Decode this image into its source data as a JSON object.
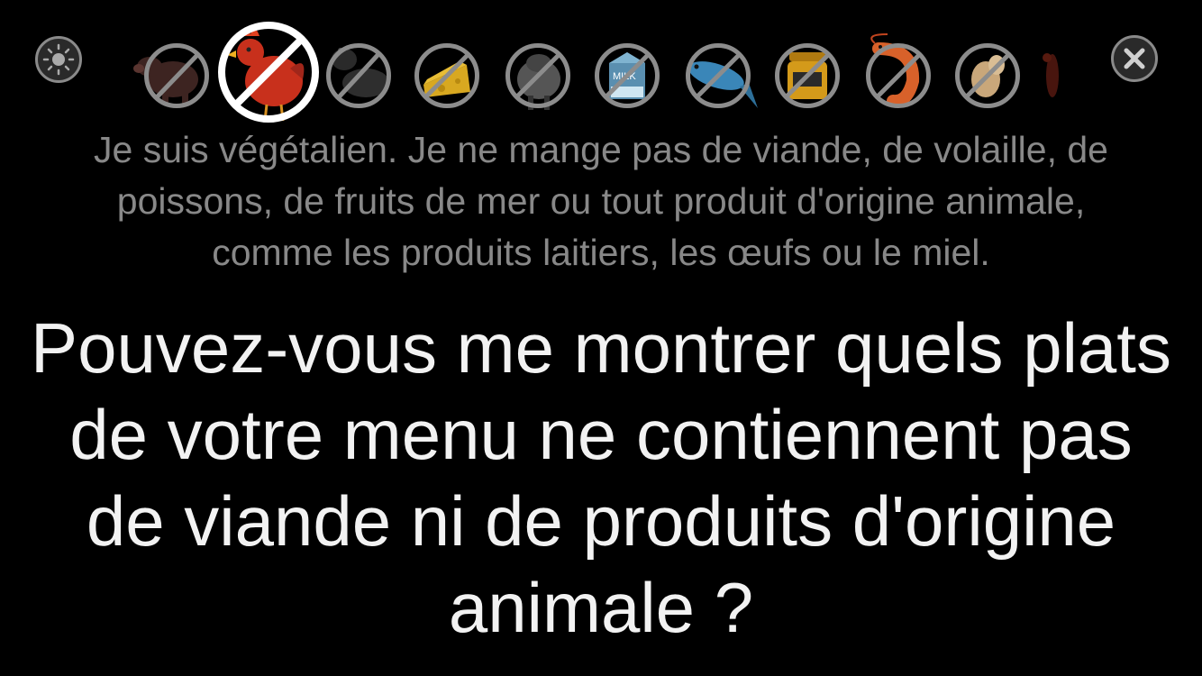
{
  "toolbar": {
    "brightness_icon": "sun-icon",
    "close_icon": "close-x-icon",
    "categories": [
      {
        "name": "pig",
        "icon": "pig-icon",
        "selected": false
      },
      {
        "name": "chicken",
        "icon": "chicken-icon",
        "selected": true
      },
      {
        "name": "cow",
        "icon": "cow-icon",
        "selected": false
      },
      {
        "name": "cheese",
        "icon": "cheese-icon",
        "selected": false
      },
      {
        "name": "sheep",
        "icon": "sheep-icon",
        "selected": false
      },
      {
        "name": "milk",
        "icon": "milk-carton-icon",
        "label": "MILK",
        "selected": false
      },
      {
        "name": "fish",
        "icon": "fish-icon",
        "selected": false
      },
      {
        "name": "honey",
        "icon": "honey-jar-icon",
        "selected": false
      },
      {
        "name": "shrimp",
        "icon": "shrimp-icon",
        "selected": false
      },
      {
        "name": "egg",
        "icon": "egg-icon",
        "selected": false
      },
      {
        "name": "lobster",
        "icon": "lobster-icon",
        "selected": false
      }
    ]
  },
  "statement": {
    "line1": "Je suis végétalien. Je ne mange pas de viande, de volaille, de",
    "line2": "poissons, de fruits de mer ou tout produit d'origine animale,",
    "line3": "comme les produits laitiers, les œufs ou le miel."
  },
  "question": {
    "line1": "Pouvez-vous me montrer quels plats",
    "line2": "de votre menu ne contiennent pas",
    "line3": "de viande ni de produits d'origine",
    "line4": "animale ?"
  },
  "colors": {
    "background": "#000000",
    "statement_text": "#888888",
    "question_text": "#f2f2f2",
    "ring": "#8c8c8c",
    "selected_ring": "#ffffff"
  }
}
